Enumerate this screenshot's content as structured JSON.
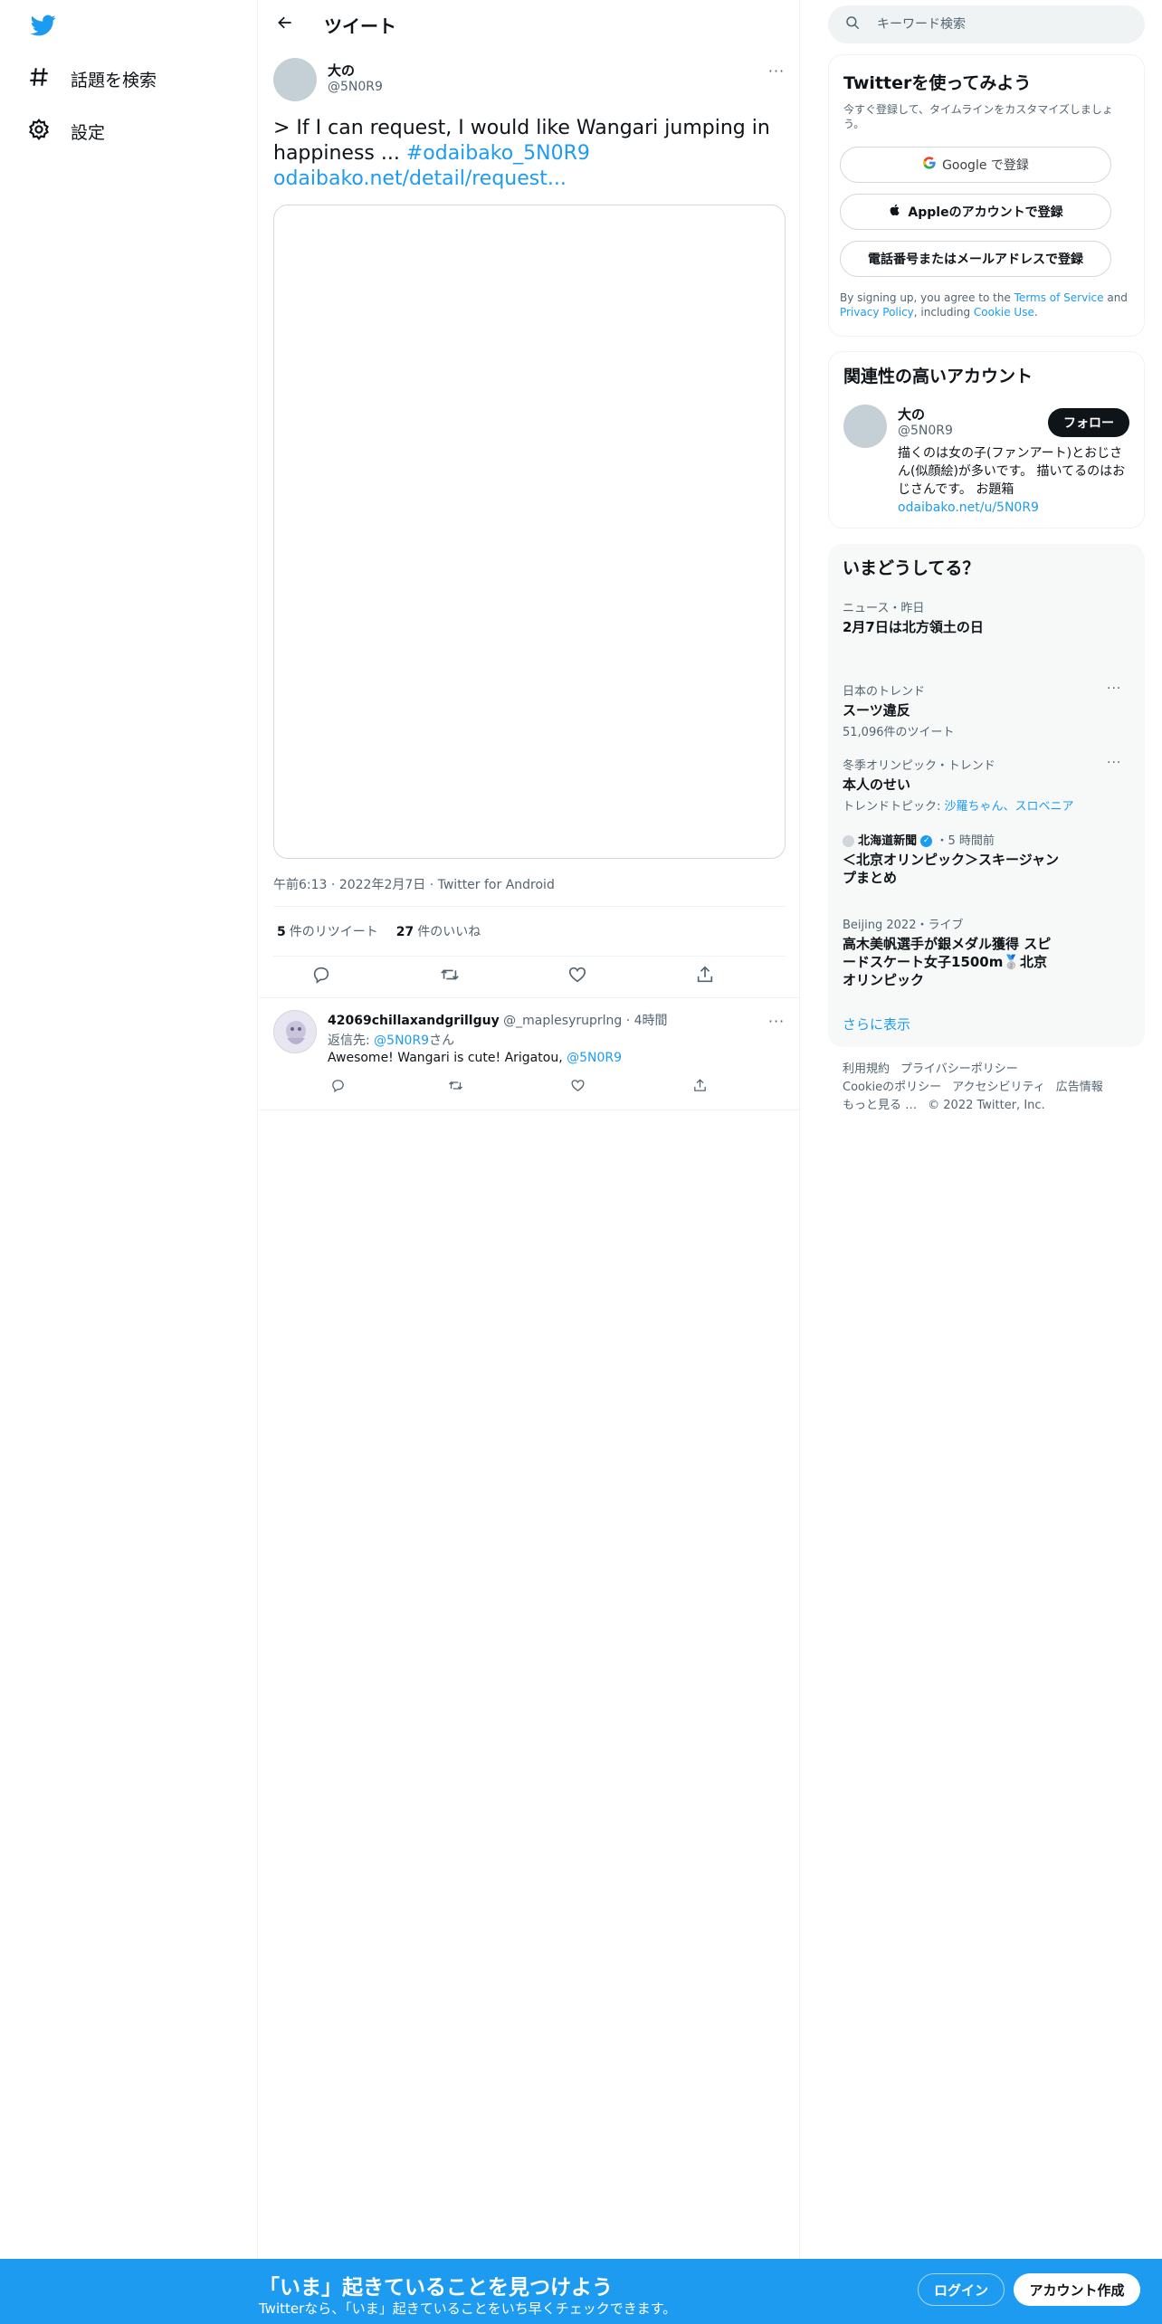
{
  "nav": {
    "items": [
      {
        "label": "話題を検索",
        "icon": "hashtag-icon"
      },
      {
        "label": "設定",
        "icon": "gear-icon"
      }
    ]
  },
  "header": {
    "title": "ツイート"
  },
  "tweet": {
    "author_name": "大の",
    "author_handle": "@5N0R9",
    "text_prefix": "> If I can request, I would like Wangari jumping in happiness ... ",
    "hashtag": "#odaibako_5N0R9",
    "link": "odaibako.net/detail/request...",
    "time": "午前6:13",
    "date": "2022年2月7日",
    "source": "Twitter for Android",
    "separator": " · ",
    "retweets": "5",
    "retweets_label": "件のリツイート",
    "likes": "27",
    "likes_label": "件のいいね"
  },
  "reply": {
    "name": "42069chillaxandgrillguy",
    "handle": "@_maplesyruprlng",
    "time": "4時間",
    "reply_to_label": "返信先: ",
    "reply_to_handle": "@5N0R9",
    "reply_to_suffix": "さん",
    "text": "Awesome! Wangari is cute! Arigatou, ",
    "mention": "@5N0R9"
  },
  "search": {
    "placeholder": "キーワード検索"
  },
  "signup_card": {
    "title": "Twitterを使ってみよう",
    "subtitle": "今すぐ登録して、タイムラインをカスタマイズしましょう。",
    "google_label": "Google で登録",
    "apple_label": "Appleのアカウントで登録",
    "phone_label": "電話番号またはメールアドレスで登録",
    "terms_prefix": "By signing up, you agree to the ",
    "terms_link": "Terms of Service",
    "terms_and": " and ",
    "privacy_link": "Privacy Policy",
    "terms_including": ", including ",
    "cookie_link": "Cookie Use",
    "terms_end": "."
  },
  "related": {
    "title": "関連性の高いアカウント",
    "name": "大の",
    "handle": "@5N0R9",
    "follow_label": "フォロー",
    "bio": "描くのは女の子(ファンアート)とおじさん(似顔絵)が多いです。 描いてるのはおじさんです。 お題箱",
    "bio_link": "odaibako.net/u/5N0R9"
  },
  "trends": {
    "title": "いまどうしてる？",
    "items": [
      {
        "context": "ニュース・昨日",
        "title": "2月7日は北方領土の日",
        "count": ""
      },
      {
        "context": "日本のトレンド",
        "title": "スーツ違反",
        "count": "51,096件のツイート"
      },
      {
        "context": "冬季オリンピック・トレンド",
        "title": "本人のせい",
        "count_prefix": "トレンドトピック: ",
        "count_link": "沙羅ちゃん、スロベニア"
      },
      {
        "source": "北海道新聞",
        "time": "・5 時間前",
        "title": "＜北京オリンピック＞スキージャンプまとめ"
      },
      {
        "context": "Beijing 2022・ライブ",
        "title": "高木美帆選手が銀メダル獲得 スピードスケート女子1500m🥈北京オリンピック"
      }
    ],
    "show_more": "さらに表示"
  },
  "footer": {
    "links": [
      "利用規約",
      "プライバシーポリシー",
      "Cookieのポリシー",
      "アクセシビリティ",
      "広告情報",
      "もっと見る …",
      "© 2022 Twitter, Inc."
    ]
  },
  "bottom_bar": {
    "title": "「いま」起きていることを見つけよう",
    "subtitle": "Twitterなら、「いま」起きていることをいち早くチェックできます。",
    "login_label": "ログイン",
    "signup_label": "アカウント作成"
  },
  "colors": {
    "accent": "#1d9bf0",
    "text": "#0f1419",
    "muted": "#536471"
  }
}
